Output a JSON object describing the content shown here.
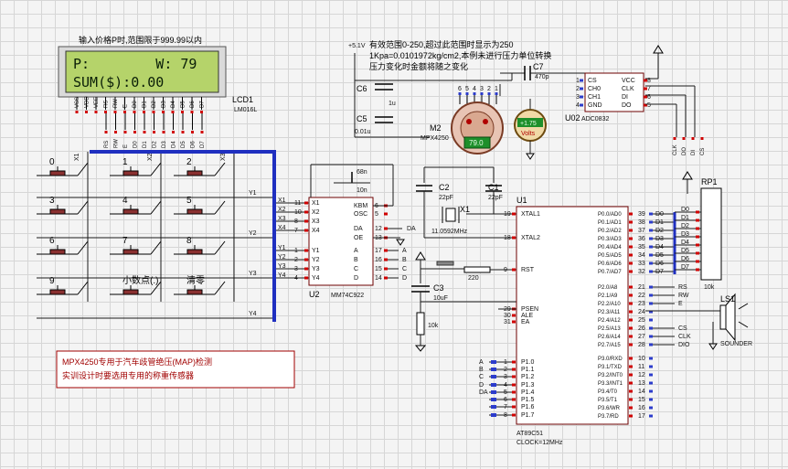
{
  "top_note": "输入价格P时,范围限于999.99以内",
  "pressure_note_1": "有效范围0-250,超过此范围时显示为250",
  "pressure_note_2": "1Kpa=0.0101972kg/cm2,本例未进行压力单位转换",
  "pressure_note_3": "压力变化时金额将随之变化",
  "vcc_label": "+5.1V",
  "lcd": {
    "name": "LCD1",
    "model": "LM016L",
    "line1": "P:        W: 79",
    "line2": "SUM($):0.00",
    "pins": [
      "VSS",
      "VDD",
      "VEE",
      "RS",
      "RW",
      "E",
      "D0",
      "D1",
      "D2",
      "D3",
      "D4",
      "D5",
      "D6",
      "D7"
    ],
    "net_labels": [
      "RS",
      "RW",
      "E",
      "D0",
      "D1",
      "D2",
      "D3",
      "D4",
      "D5",
      "D6",
      "D7"
    ]
  },
  "keypad": {
    "keys": [
      "0",
      "1",
      "2",
      "3",
      "4",
      "5",
      "6",
      "7",
      "8",
      "9",
      "小数点(.)",
      "清零"
    ],
    "col_labels": [
      "X1",
      "X2",
      "X3"
    ],
    "row_labels": [
      "Y1",
      "Y2",
      "Y3",
      "Y4"
    ]
  },
  "u2": {
    "name": "U2",
    "model": "MM74C922",
    "left_pins": [
      "X1",
      "X2",
      "X3",
      "X4",
      "Y1",
      "Y2",
      "Y3",
      "Y4"
    ],
    "left_nums": [
      "11",
      "10",
      "8",
      "7",
      "1",
      "2",
      "3",
      "4"
    ],
    "right_pins": [
      "KBM",
      "OSC",
      "DA",
      "OE",
      "A",
      "B",
      "C",
      "D"
    ],
    "right_nums": [
      "6",
      "5",
      "12",
      "13",
      "17",
      "16",
      "15",
      "14"
    ],
    "net_da": "DA",
    "cap_top": "68n",
    "cap_2": "10n"
  },
  "sensor": {
    "name": "M2",
    "model": "MPX4250",
    "value": "79.0",
    "pins": [
      "6",
      "5",
      "4",
      "3",
      "2",
      "1"
    ]
  },
  "voltmeter": {
    "value": "+1.75",
    "unit": "Volts"
  },
  "caps": {
    "c6": {
      "name": "C6",
      "value": "1u"
    },
    "c5": {
      "name": "C5",
      "value": "0.01u"
    },
    "c7": {
      "name": "C7",
      "value": "470p"
    },
    "c2": {
      "name": "C2",
      "value": "22pF"
    },
    "c1": {
      "name": "C1",
      "value": "22pF"
    },
    "c3": {
      "name": "C3",
      "value": "10uF"
    }
  },
  "adc": {
    "name": "U02",
    "model": "ADC0832",
    "left_pins": [
      "CS",
      "CH0",
      "CH1",
      "GND"
    ],
    "right_pins": [
      "VCC",
      "CLK",
      "DI",
      "DO"
    ],
    "left_nums": [
      "1",
      "2",
      "3",
      "4"
    ],
    "right_nums": [
      "8",
      "7",
      "6",
      "5"
    ],
    "net_labels": [
      "CLK",
      "DO",
      "DI",
      "CS"
    ]
  },
  "crystal": {
    "name": "X1",
    "value": "11.0592MHz"
  },
  "resistors": {
    "r_220": "220",
    "r_10k": "10k"
  },
  "u1": {
    "name": "U1",
    "model": "AT89C51",
    "clock": "CLOCK=12MHz",
    "left_pins": [
      {
        "n": "19",
        "l": "XTAL1"
      },
      {
        "n": "18",
        "l": "XTAL2"
      },
      {
        "n": "9",
        "l": "RST"
      },
      {
        "n": "29",
        "l": "PSEN"
      },
      {
        "n": "30",
        "l": "ALE"
      },
      {
        "n": "31",
        "l": "EA"
      },
      {
        "n": "1",
        "l": "P1.0"
      },
      {
        "n": "2",
        "l": "P1.1"
      },
      {
        "n": "3",
        "l": "P1.2"
      },
      {
        "n": "4",
        "l": "P1.3"
      },
      {
        "n": "5",
        "l": "P1.4"
      },
      {
        "n": "6",
        "l": "P1.5"
      },
      {
        "n": "7",
        "l": "P1.6"
      },
      {
        "n": "8",
        "l": "P1.7"
      }
    ],
    "p1_nets": [
      "A",
      "B",
      "C",
      "D",
      "DA"
    ],
    "right_pins": [
      {
        "n": "39",
        "l": "P0.0/AD0"
      },
      {
        "n": "38",
        "l": "P0.1/AD1"
      },
      {
        "n": "37",
        "l": "P0.2/AD2"
      },
      {
        "n": "36",
        "l": "P0.3/AD3"
      },
      {
        "n": "35",
        "l": "P0.4/AD4"
      },
      {
        "n": "34",
        "l": "P0.5/AD5"
      },
      {
        "n": "33",
        "l": "P0.6/AD6"
      },
      {
        "n": "32",
        "l": "P0.7/AD7"
      },
      {
        "n": "21",
        "l": "P2.0/A8"
      },
      {
        "n": "22",
        "l": "P2.1/A9"
      },
      {
        "n": "23",
        "l": "P2.2/A10"
      },
      {
        "n": "24",
        "l": "P2.3/A11"
      },
      {
        "n": "25",
        "l": "P2.4/A12"
      },
      {
        "n": "26",
        "l": "P2.5/A13"
      },
      {
        "n": "27",
        "l": "P2.6/A14"
      },
      {
        "n": "28",
        "l": "P2.7/A15"
      },
      {
        "n": "10",
        "l": "P3.0/RXD"
      },
      {
        "n": "11",
        "l": "P3.1/TXD"
      },
      {
        "n": "12",
        "l": "P3.2/INT0"
      },
      {
        "n": "13",
        "l": "P3.3/INT1"
      },
      {
        "n": "14",
        "l": "P3.4/T0"
      },
      {
        "n": "15",
        "l": "P3.5/T1"
      },
      {
        "n": "16",
        "l": "P3.6/WR"
      },
      {
        "n": "17",
        "l": "P3.7/RD"
      }
    ],
    "p0_nets": [
      "D0",
      "D1",
      "D2",
      "D3",
      "D4",
      "D5",
      "D6",
      "D7"
    ],
    "p2_nets": [
      "RS",
      "RW",
      "E",
      "",
      "",
      "CS",
      "CLK",
      "DIO"
    ]
  },
  "rp1": {
    "name": "RP1",
    "value": "10k"
  },
  "buzzer": {
    "name": "LS1",
    "model": "SOUNDER"
  },
  "bottom_note_1": "MPX4250专用于汽车歧管绝压(MAP)检测",
  "bottom_note_2": "实训设计时要选用专用的称重传感器",
  "colors": {
    "pin": "#d00000",
    "bus": "#1f2fc0",
    "lcd_bg": "#b5d36a",
    "chip_border": "#6d0000",
    "note": "#a00000"
  }
}
